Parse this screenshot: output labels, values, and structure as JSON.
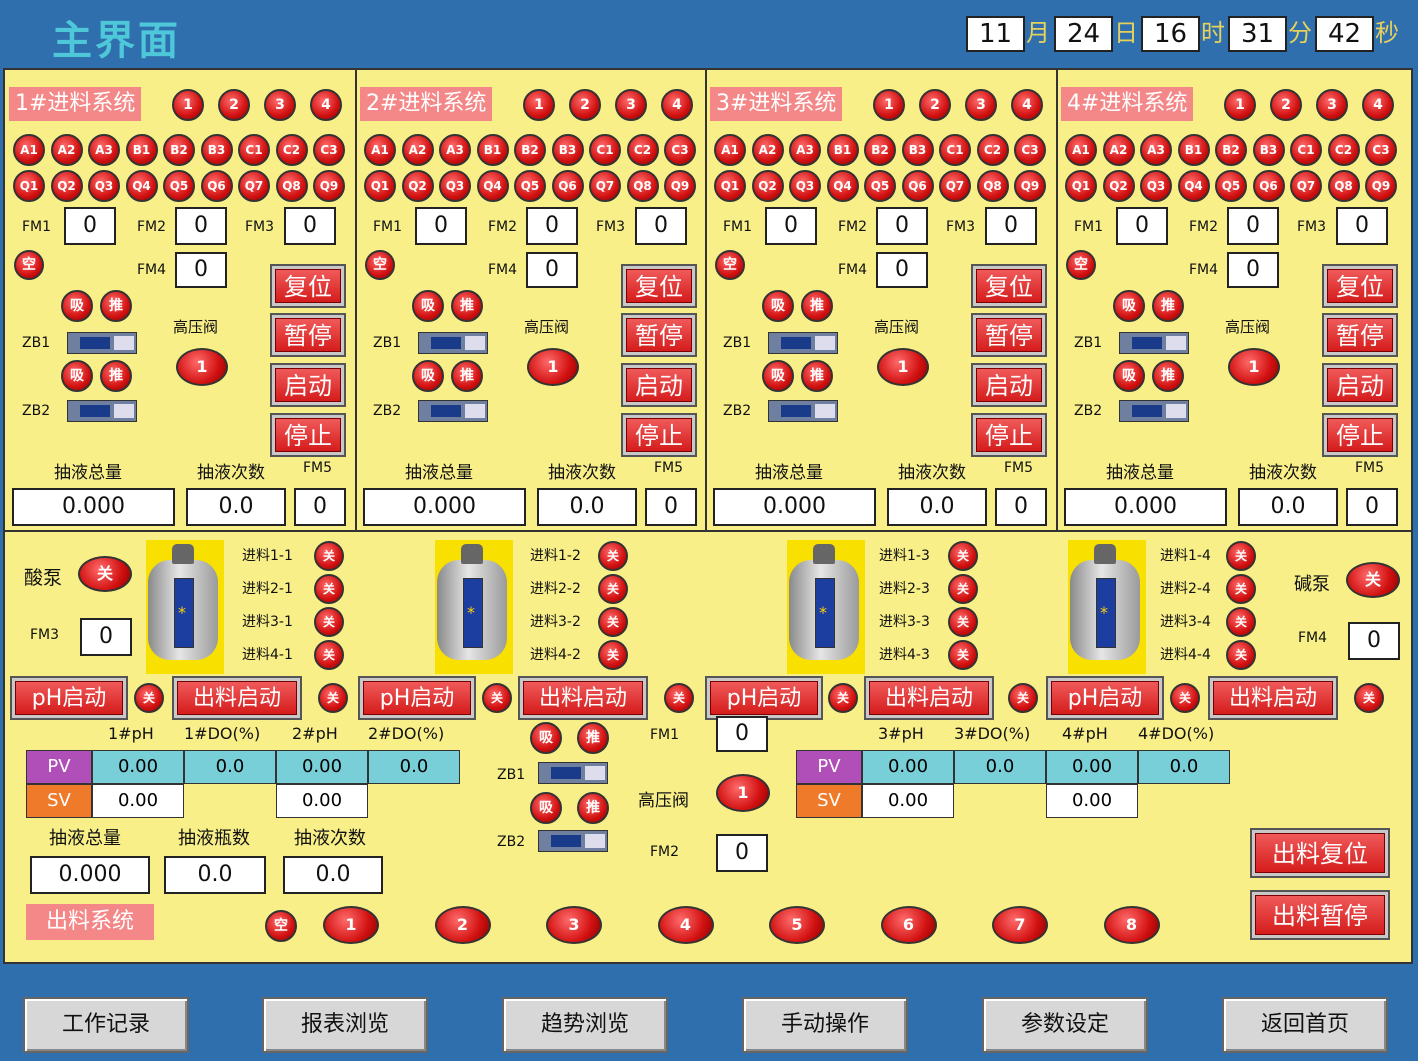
{
  "header": {
    "title": "主界面",
    "datetime": [
      {
        "value": "11",
        "unit": "月"
      },
      {
        "value": "24",
        "unit": "日"
      },
      {
        "value": "16",
        "unit": "时"
      },
      {
        "value": "31",
        "unit": "分"
      },
      {
        "value": "42",
        "unit": "秒"
      }
    ]
  },
  "feed_systems": [
    {
      "title": "1#进料系统"
    },
    {
      "title": "2#进料系统"
    },
    {
      "title": "3#进料系统"
    },
    {
      "title": "4#进料系统"
    }
  ],
  "feed_common": {
    "led_top": [
      "1",
      "2",
      "3",
      "4"
    ],
    "row1": [
      "A1",
      "A2",
      "A3",
      "B1",
      "B2",
      "B3",
      "C1",
      "C2",
      "C3"
    ],
    "row2": [
      "Q1",
      "Q2",
      "Q3",
      "Q4",
      "Q5",
      "Q6",
      "Q7",
      "Q8",
      "Q9"
    ],
    "fm1_label": "FM1",
    "fm2_label": "FM2",
    "fm3_label": "FM3",
    "fm4_label": "FM4",
    "fm5_label": "FM5",
    "fm1": "0",
    "fm2": "0",
    "fm3": "0",
    "fm4": "0",
    "fm5": "0",
    "empty_led": "空",
    "suck": "吸",
    "push": "推",
    "zb1": "ZB1",
    "zb2": "ZB2",
    "hp_label": "高压阀",
    "hp_led": "1",
    "reset": "复位",
    "pause": "暂停",
    "start": "启动",
    "stop": "停止",
    "total_label": "抽液总量",
    "count_label": "抽液次数",
    "total": "0.000",
    "count": "0.0"
  },
  "mixing": {
    "acid_label": "酸泵",
    "base_label": "碱泵",
    "off": "关",
    "fm3_label": "FM3",
    "fm3": "0",
    "fm4_label": "FM4",
    "fm4": "0",
    "feed_labels": [
      [
        "进料1-1",
        "进料2-1",
        "进料3-1",
        "进料4-1"
      ],
      [
        "进料1-2",
        "进料2-2",
        "进料3-2",
        "进料4-2"
      ],
      [
        "进料1-3",
        "进料2-3",
        "进料3-3",
        "进料4-3"
      ],
      [
        "进料1-4",
        "进料2-4",
        "进料3-4",
        "进料4-4"
      ]
    ],
    "ph_start": "pH启动",
    "out_start": "出料启动"
  },
  "readings_left": {
    "headers": [
      "1#pH",
      "1#DO(%)",
      "2#pH",
      "2#DO(%)"
    ],
    "pv_label": "PV",
    "sv_label": "SV",
    "pv": [
      "0.00",
      "0.0",
      "0.00",
      "0.0"
    ],
    "sv": [
      "0.00",
      "0.00"
    ]
  },
  "readings_right": {
    "headers": [
      "3#pH",
      "3#DO(%)",
      "4#pH",
      "4#DO(%)"
    ],
    "pv_label": "PV",
    "sv_label": "SV",
    "pv": [
      "0.00",
      "0.0",
      "0.00",
      "0.0"
    ],
    "sv": [
      "0.00",
      "0.00"
    ]
  },
  "discharge": {
    "total_label": "抽液总量",
    "bottles_label": "抽液瓶数",
    "count_label": "抽液次数",
    "total": "0.000",
    "bottles": "0.0",
    "count": "0.0",
    "title": "出料系统",
    "empty_led": "空",
    "leds": [
      "1",
      "2",
      "3",
      "4",
      "5",
      "6",
      "7",
      "8"
    ],
    "fm1_label": "FM1",
    "fm1": "0",
    "fm2_label": "FM2",
    "fm2": "0",
    "hp_label": "高压阀",
    "hp_led": "1",
    "reset": "出料复位",
    "pause": "出料暂停"
  },
  "nav": [
    "工作记录",
    "报表浏览",
    "趋势浏览",
    "手动操作",
    "参数设定",
    "返回首页"
  ]
}
